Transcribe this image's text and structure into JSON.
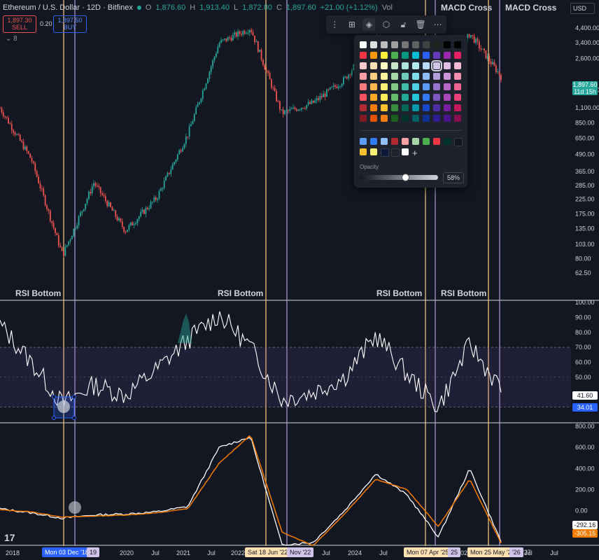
{
  "header": {
    "symbol": "Ethereum / U.S. Dollar · 12D · Bitfinex",
    "open_label": "O",
    "open_value": "1,876.60",
    "high_label": "H",
    "high_value": "1,913.40",
    "low_label": "L",
    "low_value": "1,872.80",
    "close_label": "C",
    "close_value": "1,897.60",
    "change_value": "+21.00 (+1.12%)",
    "vol_label": "Vol"
  },
  "trade": {
    "sell_price": "1,897.30",
    "sell_label": "SELL",
    "spread": "0.20",
    "buy_price": "1,897.50",
    "buy_label": "BUY"
  },
  "indicators_count": "8",
  "currency": "USD",
  "annotations": {
    "rsi_bottom": "RSI Bottom",
    "macd_cross": "MACD Cross"
  },
  "toolbar": {
    "icons": [
      "drag-handle-icon",
      "template-icon",
      "fill-color-icon",
      "settings-hex-icon",
      "lock-icon",
      "trash-icon",
      "more-icon"
    ]
  },
  "palette": {
    "opacity_label": "Opacity",
    "opacity_value": "58%",
    "opacity_fraction": 0.58,
    "selected_color": "#d1c4e9"
  },
  "price_axis": {
    "labels": [
      "4,400.00",
      "3,400.00",
      "2,600.00",
      "1,500.00",
      "1,100.00",
      "850.00",
      "650.00",
      "490.00",
      "365.00",
      "285.00",
      "225.00",
      "175.00",
      "135.00",
      "103.00",
      "80.00",
      "62.50"
    ],
    "current_price": "1,897.60",
    "countdown": "11d 15h"
  },
  "rsi_axis": {
    "labels": [
      "100.00",
      "90.00",
      "80.00",
      "70.00",
      "60.00",
      "50.00",
      "30.00"
    ],
    "current": "41.60",
    "ma": "34.01"
  },
  "macd_axis": {
    "labels": [
      "800.00",
      "600.00",
      "400.00",
      "200.00",
      "0.00",
      "-200.00"
    ],
    "macd_value": "-292.16",
    "signal_value": "-305.15"
  },
  "time_axis": {
    "labels": [
      "2018",
      "Jul",
      "2020",
      "Jul",
      "2021",
      "Jul",
      "2022",
      "Jul",
      "2024",
      "Jul",
      "2025",
      "Jul",
      "Jul"
    ],
    "badges": [
      {
        "text": "Mon 03 Dec '18",
        "color": "#2962ff"
      },
      {
        "text": "19",
        "color": "#d1c4e9"
      },
      {
        "text": "Sat 18 Jun '22",
        "color": "#ffe0b2"
      },
      {
        "text": "Nov '22",
        "color": "#d1c4e9"
      },
      {
        "text": "Mon 07 Apr '25",
        "color": "#ffe0b2"
      },
      {
        "text": "25",
        "color": "#d1c4e9"
      },
      {
        "text": "Mon 25 May '26",
        "color": "#ffe0b2"
      },
      {
        "text": "'26",
        "color": "#d1c4e9"
      },
      {
        "text": "'27",
        "color": ""
      }
    ]
  },
  "colors": {
    "bg": "#131722",
    "up": "#26a69a",
    "down": "#ef5350",
    "rsi_line": "#ffffff",
    "macd_line": "#ffffff",
    "signal_line": "#f57c00",
    "orange_vline": "#ffcc80",
    "lavender_vline": "#b39ddb"
  },
  "chart_data": {
    "type": "line",
    "price_series": {
      "x": [
        "2018-01",
        "2018-06",
        "2018-12",
        "2019-06",
        "2019-12",
        "2020-06",
        "2020-12",
        "2021-05",
        "2021-11",
        "2022-06",
        "2022-11",
        "2023-06",
        "2024-03",
        "2024-08",
        "2025-04",
        "2025-08",
        "2026-05"
      ],
      "close": [
        1100,
        450,
        85,
        300,
        130,
        230,
        700,
        3400,
        4400,
        1000,
        1200,
        1800,
        3800,
        2500,
        1500,
        4000,
        1897.6
      ]
    },
    "rsi": {
      "values": [
        85,
        60,
        32,
        45,
        38,
        55,
        75,
        92,
        70,
        35,
        40,
        50,
        78,
        52,
        30,
        72,
        41.6
      ],
      "ma_value": 34.01,
      "band_upper": 70,
      "band_lower": 30
    },
    "macd": {
      "macd": [
        20,
        -20,
        -70,
        -40,
        -30,
        -10,
        40,
        600,
        700,
        -320,
        -300,
        0,
        350,
        150,
        -250,
        400,
        -292.16
      ],
      "signal": [
        10,
        -10,
        -60,
        -50,
        -40,
        -20,
        20,
        450,
        720,
        -200,
        -330,
        -30,
        300,
        200,
        -150,
        300,
        -305.15
      ]
    }
  }
}
